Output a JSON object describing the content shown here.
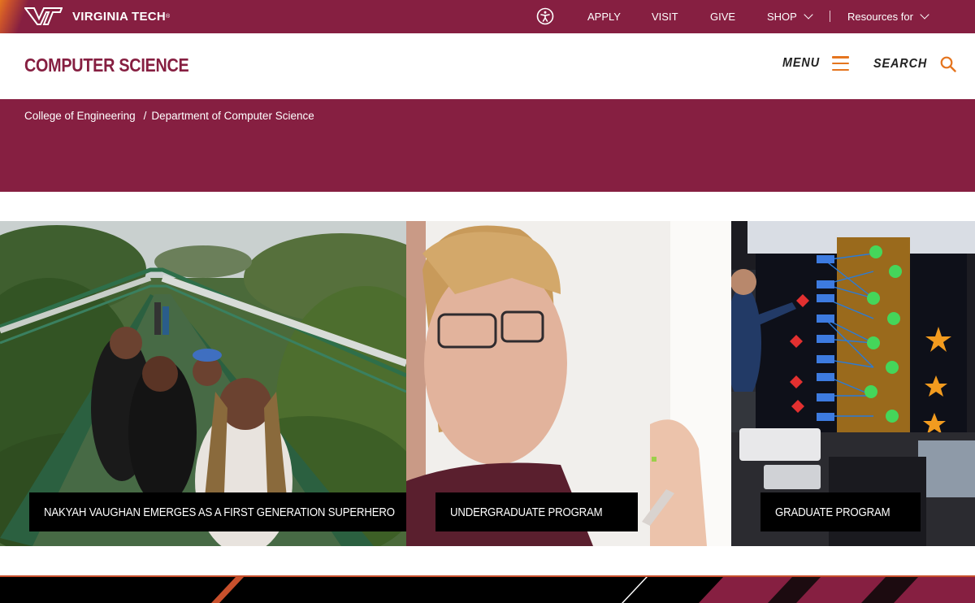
{
  "utility_bar": {
    "brand": "VIRGINIA TECH",
    "links": [
      "APPLY",
      "VISIT",
      "GIVE"
    ],
    "shop_label": "SHOP",
    "resources_label": "Resources for",
    "accessibility_icon": "accessibility-icon",
    "colors": {
      "maroon": "#861f41",
      "orange": "#e5751f"
    }
  },
  "header": {
    "site_title": "COMPUTER SCIENCE",
    "menu_label": "MENU",
    "search_label": "SEARCH"
  },
  "breadcrumb": {
    "items": [
      "College of Engineering",
      "Department of Computer Science"
    ],
    "separator": "/"
  },
  "cards": [
    {
      "label": "NAKYAH VAUGHAN EMERGES AS A FIRST GENERATION SUPERHERO"
    },
    {
      "label": "UNDERGRADUATE PROGRAM"
    },
    {
      "label": "GRADUATE PROGRAM"
    }
  ]
}
